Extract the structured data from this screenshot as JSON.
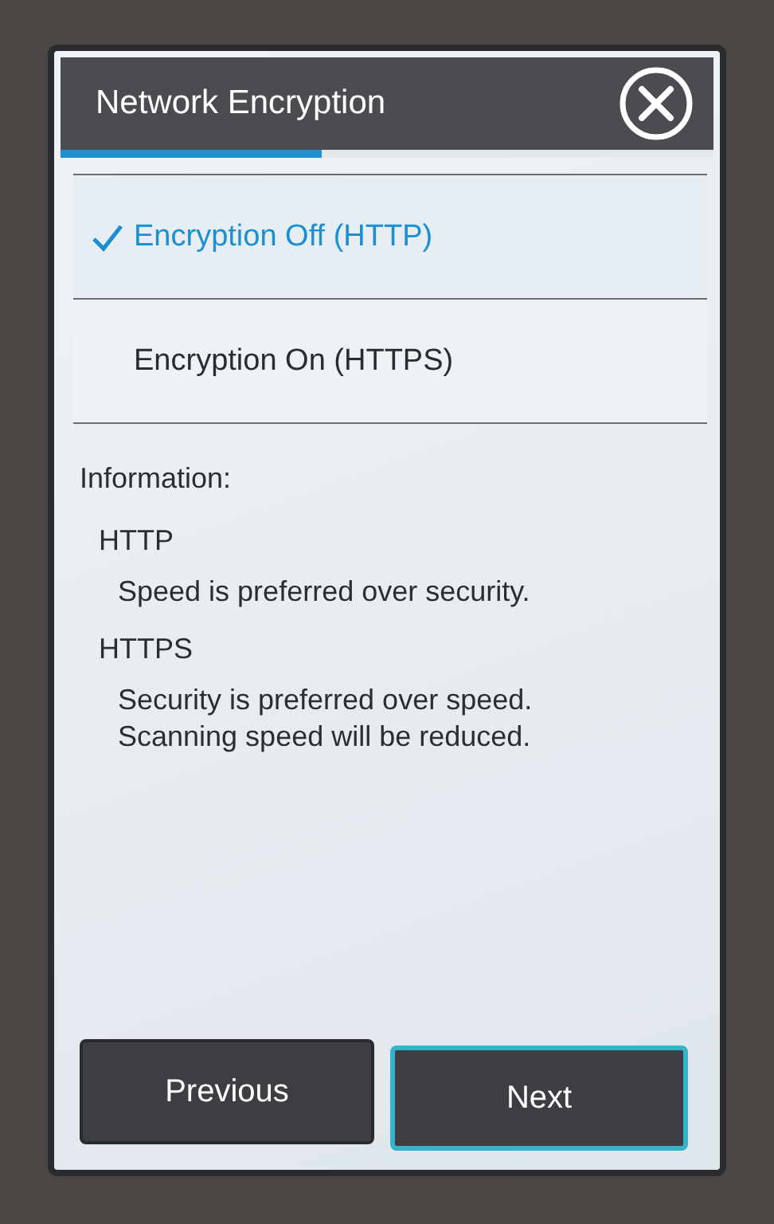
{
  "header": {
    "title": "Network Encryption"
  },
  "progress": {
    "level": 0.4
  },
  "options": [
    {
      "label": "Encryption Off (HTTP)",
      "selected": true
    },
    {
      "label": "Encryption On (HTTPS)",
      "selected": false
    }
  ],
  "information": {
    "heading": "Information:",
    "sections": [
      {
        "title": "HTTP",
        "lines": [
          "Speed is preferred over security."
        ]
      },
      {
        "title": "HTTPS",
        "lines": [
          "Security is preferred over speed.",
          "Scanning speed will be reduced."
        ]
      }
    ]
  },
  "buttons": [
    {
      "label": "Previous",
      "focused": false
    },
    {
      "label": "Next",
      "focused": true
    }
  ]
}
